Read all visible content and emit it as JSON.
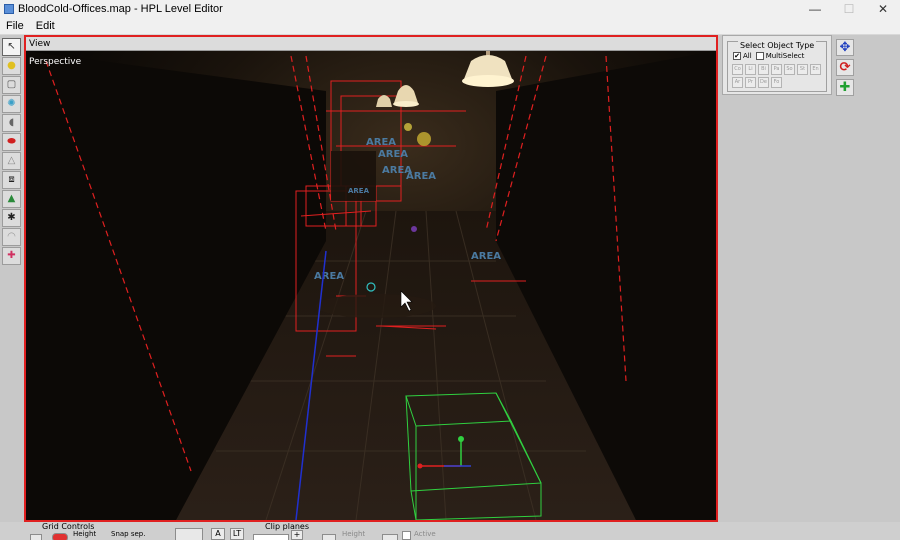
{
  "window": {
    "title": "BloodCold-Offices.map - HPL Level Editor",
    "minimize_icon": "minimize-icon",
    "maximize_icon": "maximize-icon",
    "close_icon": "close-icon"
  },
  "menu": {
    "file": "File",
    "edit": "Edit"
  },
  "toolbar": {
    "tools": [
      {
        "icon": "select-arrow-icon",
        "glyph": "↖"
      },
      {
        "icon": "light-bulb-icon",
        "glyph": "💡"
      },
      {
        "icon": "static-object-icon",
        "glyph": "▢"
      },
      {
        "icon": "particle-system-icon",
        "glyph": "✺"
      },
      {
        "icon": "sound-icon",
        "glyph": "◖"
      },
      {
        "icon": "entity-icon",
        "glyph": "⬬"
      },
      {
        "icon": "billboard-icon",
        "glyph": "△"
      },
      {
        "icon": "area-icon",
        "glyph": "⧈"
      },
      {
        "icon": "decal-icon",
        "glyph": "⛰"
      },
      {
        "icon": "primitive-icon",
        "glyph": "✱"
      },
      {
        "icon": "fog-area-icon",
        "glyph": "◠"
      },
      {
        "icon": "combine-icon",
        "glyph": "✚"
      }
    ]
  },
  "viewport": {
    "header": "View",
    "mode": "Perspective",
    "area_labels": [
      "AREA",
      "AREA",
      "AREA",
      "AREA",
      "AREA",
      "AREA",
      "AREA",
      "AREA"
    ]
  },
  "object_panel": {
    "title": "Select Object Type",
    "all_label": "All",
    "multiselect_label": "MultiSelect",
    "type_buttons": [
      "Co",
      "Li",
      "Bi",
      "Pa",
      "So",
      "St",
      "En",
      "Ar",
      "Pr",
      "De",
      "Fo"
    ]
  },
  "side_tools": {
    "translate_icon": "translate-arrows-icon",
    "rotate_icon": "rotate-icon",
    "scale_icon": "scale-plus-icon"
  },
  "bottom": {
    "grid_controls": "Grid Controls",
    "height": "Height",
    "snap_sep": "Snap sep.",
    "a_button": "A",
    "lt_button": "LT",
    "clip_planes": "Clip planes",
    "plus_button": "+",
    "clip_height": "Height",
    "active": "Active"
  }
}
